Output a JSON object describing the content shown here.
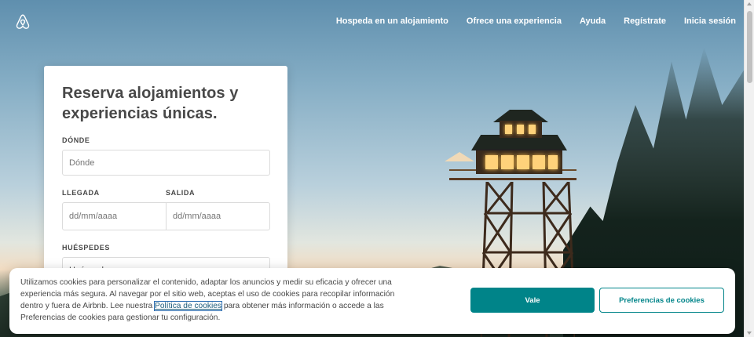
{
  "nav": {
    "links": [
      "Hospeda en un alojamiento",
      "Ofrece una experiencia",
      "Ayuda",
      "Regístrate",
      "Inicia sesión"
    ]
  },
  "search": {
    "title": "Reserva alojamientos y experiencias únicas.",
    "where_label": "DÓNDE",
    "where_placeholder": "Dónde",
    "checkin_label": "LLEGADA",
    "checkin_placeholder": "dd/mm/aaaa",
    "checkout_label": "SALIDA",
    "checkout_placeholder": "dd/mm/aaaa",
    "guests_label": "HUÉSPEDES",
    "guests_value": "Huéspedes"
  },
  "cookie": {
    "text_before": "Utilizamos cookies para personalizar el contenido, adaptar los anuncios y medir su eficacia y ofrecer una experiencia más segura. Al navegar por el sitio web, aceptas el uso de cookies para recopilar información dentro y fuera de Airbnb. Lee nuestra ",
    "link": "Política de cookies",
    "text_after": " para obtener más información o accede a las Preferencias de cookies para gestionar tu configuración.",
    "accept_label": "Vale",
    "prefs_label": "Preferencias de cookies"
  },
  "colors": {
    "accent": "#008489",
    "text": "#484848"
  },
  "icons": [
    "airbnb-logo-icon",
    "chevron-down-icon"
  ]
}
